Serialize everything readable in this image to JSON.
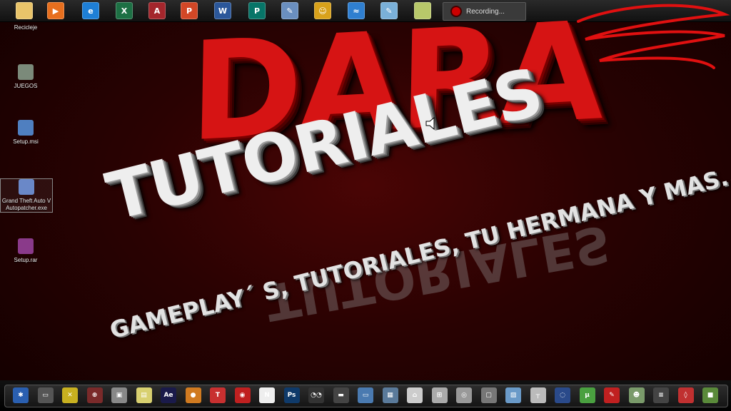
{
  "taskbar": {
    "pinned": [
      {
        "name": "folder-icon",
        "glyph": "",
        "color": "#e9c46a"
      },
      {
        "name": "media-player-icon",
        "glyph": "▶",
        "color": "#e76f1e"
      },
      {
        "name": "internet-explorer-icon",
        "glyph": "e",
        "color": "#1e7fd6"
      },
      {
        "name": "excel-icon",
        "glyph": "X",
        "color": "#1d7044"
      },
      {
        "name": "access-icon",
        "glyph": "A",
        "color": "#a4262c"
      },
      {
        "name": "powerpoint-icon",
        "glyph": "P",
        "color": "#d24726"
      },
      {
        "name": "word-icon",
        "glyph": "W",
        "color": "#2b579a"
      },
      {
        "name": "publisher-icon",
        "glyph": "P",
        "color": "#077568"
      },
      {
        "name": "paint-icon",
        "glyph": "✎",
        "color": "#6a8fbf"
      },
      {
        "name": "game-icon",
        "glyph": "☺",
        "color": "#d9a21b"
      },
      {
        "name": "wifi-icon",
        "glyph": "≈",
        "color": "#2f7fd0"
      },
      {
        "name": "notepad-icon",
        "glyph": "✎",
        "color": "#7ab0d8"
      },
      {
        "name": "folder-green-icon",
        "glyph": "",
        "color": "#b8c86a"
      }
    ],
    "recording_label": "Recording..."
  },
  "desktop_icons": [
    {
      "label": "Recicleje",
      "color": "#aab6c4"
    },
    {
      "label": "JUEGOS",
      "color": "#7b8a7a"
    },
    {
      "label": "Setup.msi",
      "color": "#4f7fc0"
    },
    {
      "label": "Grand Theft Auto V Autopatcher.exe",
      "color": "#6a88c8"
    },
    {
      "label": "Setup.rar",
      "color": "#8a3a8a"
    }
  ],
  "wallpaper": {
    "title": "DARA",
    "subtitle": "TUTORIALES",
    "tagline": "GAMEPLAY´ S, TUTORIALES, TU HERMANA Y MAS......",
    "accent": "#d61414"
  },
  "dock": {
    "icons": [
      {
        "name": "bluetooth-icon",
        "glyph": "✱",
        "color": "#2a5fb0"
      },
      {
        "name": "computer-icon",
        "glyph": "▭",
        "color": "#555"
      },
      {
        "name": "tools-icon",
        "glyph": "✕",
        "color": "#c8b020"
      },
      {
        "name": "game-pad-icon",
        "glyph": "⊕",
        "color": "#7a2a2a"
      },
      {
        "name": "image-viewer-icon",
        "glyph": "▣",
        "color": "#888"
      },
      {
        "name": "notes-icon",
        "glyph": "▤",
        "color": "#d8d070"
      },
      {
        "name": "after-effects-icon",
        "glyph": "Ae",
        "color": "#1a1a4a"
      },
      {
        "name": "burger-icon",
        "glyph": "●",
        "color": "#d07a20"
      },
      {
        "name": "tag-icon",
        "glyph": "T",
        "color": "#c83030"
      },
      {
        "name": "capture-icon",
        "glyph": "◉",
        "color": "#c02020"
      },
      {
        "name": "netflix-icon",
        "glyph": "N",
        "color": "#eeeeee"
      },
      {
        "name": "photoshop-icon",
        "glyph": "Ps",
        "color": "#0f3a6a"
      },
      {
        "name": "eyes-icon",
        "glyph": "◔◔",
        "color": "#333"
      },
      {
        "name": "bar-icon",
        "glyph": "▬",
        "color": "#444"
      },
      {
        "name": "monitor-icon",
        "glyph": "▭",
        "color": "#4a7ab0"
      },
      {
        "name": "image-icon",
        "glyph": "▦",
        "color": "#5a7a9a"
      },
      {
        "name": "home-icon",
        "glyph": "⌂",
        "color": "#ccc"
      },
      {
        "name": "network-icon",
        "glyph": "⊞",
        "color": "#aaa"
      },
      {
        "name": "camera-icon",
        "glyph": "◎",
        "color": "#999"
      },
      {
        "name": "file-icon",
        "glyph": "▢",
        "color": "#777"
      },
      {
        "name": "picture-icon",
        "glyph": "▨",
        "color": "#6a9ac8"
      },
      {
        "name": "sign-icon",
        "glyph": "┬",
        "color": "#bbb"
      },
      {
        "name": "cinema4d-icon",
        "glyph": "◌",
        "color": "#2a4a8a"
      },
      {
        "name": "utorrent-icon",
        "glyph": "µ",
        "color": "#4aa040"
      },
      {
        "name": "pin-icon",
        "glyph": "✎",
        "color": "#c02020"
      },
      {
        "name": "zombie-icon",
        "glyph": "☻",
        "color": "#7a9a6a"
      },
      {
        "name": "stripes-icon",
        "glyph": "≡",
        "color": "#444"
      },
      {
        "name": "wire-icon",
        "glyph": "◊",
        "color": "#c03030"
      },
      {
        "name": "minecraft-icon",
        "glyph": "■",
        "color": "#5a8a3a"
      }
    ]
  }
}
